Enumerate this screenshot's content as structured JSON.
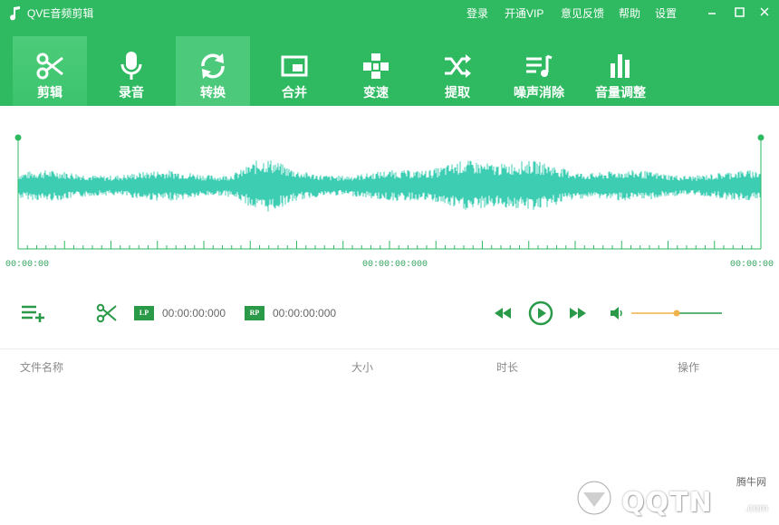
{
  "app": {
    "title": "QVE音频剪辑",
    "accent": "#2fba61",
    "wave_color": "#3ccdb3"
  },
  "menu": [
    {
      "label": "登录"
    },
    {
      "label": "开通VIP"
    },
    {
      "label": "意见反馈"
    },
    {
      "label": "帮助"
    },
    {
      "label": "设置"
    }
  ],
  "window_controls": [
    "minimize-icon",
    "maximize-icon",
    "close-icon"
  ],
  "tools": [
    {
      "label": "剪辑",
      "icon": "scissors-icon",
      "active": true
    },
    {
      "label": "录音",
      "icon": "microphone-icon"
    },
    {
      "label": "转换",
      "icon": "convert-icon"
    },
    {
      "label": "合并",
      "icon": "merge-icon"
    },
    {
      "label": "变速",
      "icon": "speed-icon"
    },
    {
      "label": "提取",
      "icon": "shuffle-icon"
    },
    {
      "label": "噪声消除",
      "icon": "playlist-icon"
    },
    {
      "label": "音量调整",
      "icon": "bars-icon"
    }
  ],
  "timeline": {
    "start": "00:00:00",
    "middle": "00:00:00:000",
    "end": "00:00:00"
  },
  "controls": {
    "lp_tag": "LP",
    "lp_time": "00:00:00:000",
    "rp_tag": "RP",
    "rp_time": "00:00:00:000",
    "volume_fraction": 0.5
  },
  "file_list": {
    "columns": [
      "文件名称",
      "大小",
      "时长",
      "操作"
    ]
  },
  "watermark": {
    "text": "QQTN",
    "site": "腾牛网",
    "suffix": ".com"
  }
}
